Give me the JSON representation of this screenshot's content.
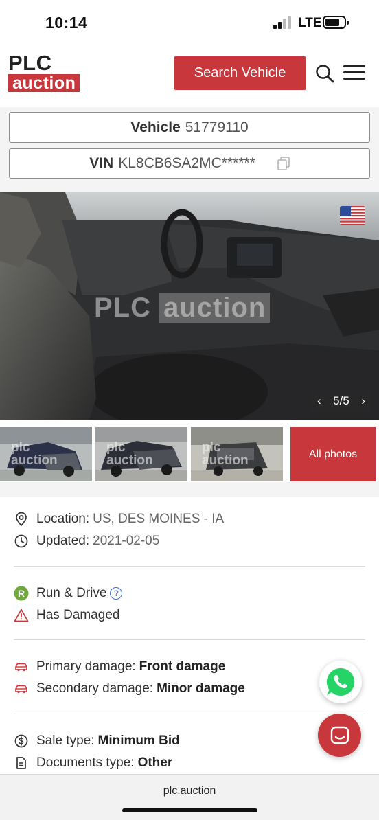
{
  "status_bar": {
    "time": "10:14",
    "network": "LTE"
  },
  "header": {
    "logo_top": "PLC",
    "logo_bottom": "auction",
    "search_button": "Search Vehicle"
  },
  "vehicle": {
    "vehicle_label": "Vehicle",
    "vehicle_number": "51779110",
    "vin_label": "VIN",
    "vin_value": "KL8CB6SA2MC******"
  },
  "gallery": {
    "watermark_left": "PLC",
    "watermark_right": "auction",
    "counter": "5/5",
    "all_photos": "All photos",
    "thumb_watermark_top": "plc",
    "thumb_watermark_bottom": "auction"
  },
  "details": {
    "location_label": "Location:",
    "location_value": "US, DES MOINES - IA",
    "updated_label": "Updated:",
    "updated_value": "2021-02-05",
    "run_drive": "Run & Drive",
    "run_drive_badge": "R",
    "has_damaged": "Has Damaged",
    "primary_label": "Primary damage:",
    "primary_value": "Front damage",
    "secondary_label": "Secondary damage:",
    "secondary_value": "Minor damage",
    "sale_type_label": "Sale type:",
    "sale_type_value": "Minimum Bid",
    "documents_label": "Documents type:",
    "documents_value": "Other"
  },
  "browser": {
    "url": "plc.auction"
  },
  "colors": {
    "brand_red": "#c8373b",
    "run_drive_green": "#6fa83b",
    "help_blue": "#3b6fd1",
    "whatsapp_green": "#25d366"
  }
}
